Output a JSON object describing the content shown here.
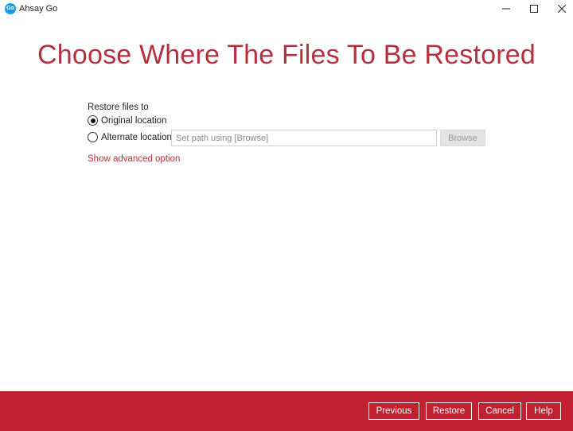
{
  "window": {
    "app_icon_text": "Go",
    "title": "Ahsay Go"
  },
  "page": {
    "title": "Choose Where The Files To Be Restored"
  },
  "restore": {
    "label": "Restore files to",
    "options": [
      {
        "label": "Original location",
        "selected": true
      },
      {
        "label": "Alternate location",
        "selected": false
      }
    ],
    "path_placeholder": "Set path using [Browse]",
    "path_value": "",
    "browse_label": "Browse",
    "advanced_link": "Show advanced option"
  },
  "footer": {
    "previous": "Previous",
    "restore": "Restore",
    "cancel": "Cancel",
    "help": "Help"
  },
  "colors": {
    "accent": "#b5303e",
    "footer_bg": "#c02030"
  }
}
